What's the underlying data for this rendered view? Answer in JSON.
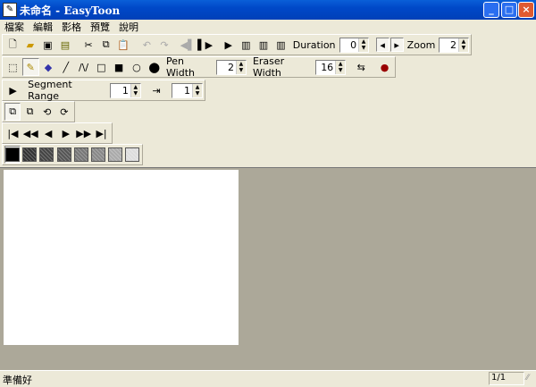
{
  "window": {
    "title": "未命名 - EasyToon",
    "minimize": "_",
    "maximize": "□",
    "close": "×"
  },
  "menu": [
    "檔案",
    "編輯",
    "影格",
    "預覽",
    "說明"
  ],
  "toolbar1": {
    "duration_label": "Duration",
    "duration_value": "0",
    "zoom_label": "Zoom",
    "zoom_value": "2"
  },
  "toolbar2": {
    "pen_width_label": "Pen Width",
    "pen_width_value": "2",
    "eraser_width_label": "Eraser Width",
    "eraser_width_value": "16"
  },
  "toolbar3": {
    "segment_range_label": "Segment Range",
    "start_value": "1",
    "end_value": "1"
  },
  "patterns": [
    "#000000",
    "#333333",
    "#444444",
    "#555555",
    "#777777",
    "#888888",
    "#aaaaaa",
    "#dddddd"
  ],
  "status": {
    "text": "準備好",
    "page": "1/1"
  }
}
